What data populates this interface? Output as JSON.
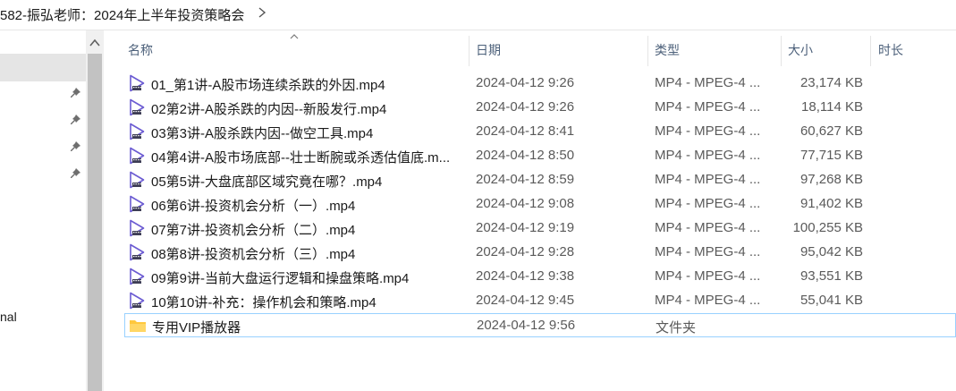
{
  "breadcrumb": {
    "path": "582-振弘老师：2024年上半年投资策略会"
  },
  "navpane": {
    "visible_label": "nal"
  },
  "columns": {
    "name": "名称",
    "date": "日期",
    "type": "类型",
    "size": "大小",
    "duration": "时长"
  },
  "files": [
    {
      "name": "01_第1讲-A股市场连续杀跌的外因.mp4",
      "date": "2024-04-12 9:26",
      "type": "MP4 - MPEG-4 ...",
      "size": "23,174 KB",
      "icon": "video-file-icon"
    },
    {
      "name": "02第2讲-A股杀跌的内因--新股发行.mp4",
      "date": "2024-04-12 9:26",
      "type": "MP4 - MPEG-4 ...",
      "size": "18,114 KB",
      "icon": "video-file-icon"
    },
    {
      "name": "03第3讲-A股杀跌内因--做空工具.mp4",
      "date": "2024-04-12 8:41",
      "type": "MP4 - MPEG-4 ...",
      "size": "60,627 KB",
      "icon": "video-file-icon"
    },
    {
      "name": "04第4讲-A股市场底部--壮士断腕或杀透估值底.m...",
      "date": "2024-04-12 8:50",
      "type": "MP4 - MPEG-4 ...",
      "size": "77,715 KB",
      "icon": "video-file-icon"
    },
    {
      "name": "05第5讲-大盘底部区域究竟在哪？.mp4",
      "date": "2024-04-12 8:59",
      "type": "MP4 - MPEG-4 ...",
      "size": "97,268 KB",
      "icon": "video-file-icon"
    },
    {
      "name": "06第6讲-投资机会分析（一）.mp4",
      "date": "2024-04-12 9:08",
      "type": "MP4 - MPEG-4 ...",
      "size": "91,402 KB",
      "icon": "video-file-icon"
    },
    {
      "name": "07第7讲-投资机会分析（二）.mp4",
      "date": "2024-04-12 9:19",
      "type": "MP4 - MPEG-4 ...",
      "size": "100,255 KB",
      "icon": "video-file-icon"
    },
    {
      "name": "08第8讲-投资机会分析（三）.mp4",
      "date": "2024-04-12 9:28",
      "type": "MP4 - MPEG-4 ...",
      "size": "95,042 KB",
      "icon": "video-file-icon"
    },
    {
      "name": "09第9讲-当前大盘运行逻辑和操盘策略.mp4",
      "date": "2024-04-12 9:38",
      "type": "MP4 - MPEG-4 ...",
      "size": "93,551 KB",
      "icon": "video-file-icon"
    },
    {
      "name": "10第10讲-补充：操作机会和策略.mp4",
      "date": "2024-04-12 9:45",
      "type": "MP4 - MPEG-4 ...",
      "size": "55,041 KB",
      "icon": "video-file-icon"
    },
    {
      "name": "专用VIP播放器",
      "date": "2024-04-12 9:56",
      "type": "文件夹",
      "size": "",
      "icon": "folder-icon",
      "selected": true
    }
  ],
  "colors": {
    "header_text": "#4c607a",
    "selection_border": "#99d1ff",
    "nav_selected": "#e5e5e5",
    "video_icon": "#6b5bd2",
    "folder_icon": "#ffc83d"
  }
}
